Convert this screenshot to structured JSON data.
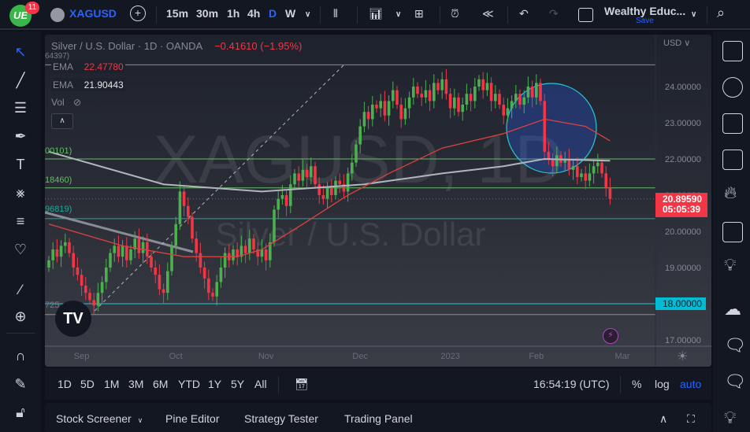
{
  "toolbar": {
    "notifications": "11",
    "symbol": "XAGUSD",
    "intervals": [
      "15m",
      "30m",
      "1h",
      "4h",
      "D",
      "W"
    ],
    "active_interval": "D",
    "layout_name": "Wealthy Educ...",
    "save_label": "Save"
  },
  "legend": {
    "title": "Silver / U.S. Dollar · 1D · OANDA",
    "change": "−0.41610 (−1.95%)",
    "cut_value": "64397)",
    "ema1_label": "EMA",
    "ema1_value": "22.47780",
    "ema2_label": "EMA",
    "ema2_value": "21.90443",
    "vol_label": "Vol"
  },
  "level_labels": [
    "00101)",
    "18460)",
    "96819)",
    "725"
  ],
  "watermark": {
    "symbol": "XAGUSD, 1D",
    "name": "Silver / U.S. Dollar"
  },
  "price_axis": {
    "currency": "USD",
    "current_price": "20.89590",
    "countdown": "05:05:39",
    "highlight_level": "18.00000"
  },
  "colors": {
    "up": "#4caf50",
    "down": "#f23645",
    "ema_fast": "#e0413f",
    "ema_slow": "#b2b5be",
    "accent": "#2962ff"
  },
  "chart_data": {
    "type": "candlestick",
    "title": "Silver / U.S. Dollar · 1D · OANDA",
    "ylim": [
      16.8,
      25.3
    ],
    "yticks": [
      17,
      18,
      19,
      20,
      21,
      22,
      23,
      24
    ],
    "ytick_labels": [
      "17.00000",
      "18.00000",
      "19.00000",
      "20.00000",
      "21.00000",
      "22.00000",
      "23.00000",
      "24.00000"
    ],
    "xticks": [
      {
        "label": "Sep",
        "index": 8
      },
      {
        "label": "Oct",
        "index": 31
      },
      {
        "label": "Nov",
        "index": 53
      },
      {
        "label": "Dec",
        "index": 76
      },
      {
        "label": "2023",
        "index": 98
      },
      {
        "label": "Feb",
        "index": 119
      },
      {
        "label": "Mar",
        "index": 140
      }
    ],
    "first_open": 19.0,
    "closes": [
      19.2,
      19.5,
      19.3,
      19.6,
      19.7,
      19.4,
      19.0,
      18.8,
      18.5,
      18.3,
      18.1,
      17.95,
      18.3,
      18.6,
      19.0,
      19.4,
      19.6,
      19.3,
      19.6,
      19.2,
      19.5,
      19.8,
      19.4,
      19.7,
      19.3,
      19.0,
      18.8,
      18.4,
      18.3,
      18.9,
      19.6,
      20.2,
      21.1,
      20.7,
      20.4,
      19.8,
      19.4,
      19.0,
      18.7,
      18.3,
      18.2,
      18.6,
      19.0,
      19.4,
      19.2,
      19.5,
      19.3,
      19.6,
      19.4,
      19.8,
      19.5,
      19.3,
      19.5,
      19.2,
      19.7,
      20.6,
      20.9,
      21.0,
      20.7,
      21.3,
      21.6,
      21.4,
      21.7,
      21.5,
      21.8,
      21.3,
      21.0,
      20.9,
      21.2,
      21.0,
      21.4,
      21.3,
      21.1,
      21.6,
      21.9,
      22.4,
      22.9,
      23.3,
      23.1,
      23.5,
      23.4,
      23.6,
      23.2,
      23.6,
      23.9,
      23.5,
      23.1,
      23.4,
      23.7,
      24.0,
      23.8,
      23.7,
      23.9,
      23.6,
      24.1,
      23.9,
      24.2,
      23.8,
      23.4,
      23.7,
      23.3,
      23.5,
      23.8,
      23.6,
      24.0,
      24.2,
      23.9,
      24.1,
      23.6,
      23.8,
      23.5,
      23.2,
      23.4,
      23.6,
      23.8,
      23.5,
      23.7,
      24.0,
      23.7,
      24.1,
      23.6,
      22.2,
      22.0,
      21.8,
      22.1,
      21.9,
      22.0,
      21.7,
      21.8,
      21.5,
      21.6,
      21.4,
      21.6,
      21.8,
      21.9,
      21.6,
      21.2,
      20.896
    ],
    "ema_fast": [
      [
        0,
        20.2
      ],
      [
        18,
        19.6
      ],
      [
        33,
        19.3
      ],
      [
        46,
        19.3
      ],
      [
        52,
        19.5
      ],
      [
        62,
        20.2
      ],
      [
        73,
        21.0
      ],
      [
        83,
        21.6
      ],
      [
        96,
        22.3
      ],
      [
        111,
        22.7
      ],
      [
        121,
        23.1
      ],
      [
        131,
        22.9
      ],
      [
        137,
        22.5
      ]
    ],
    "ema_slow": [
      [
        0,
        22.2
      ],
      [
        28,
        21.3
      ],
      [
        52,
        21.1
      ],
      [
        77,
        21.3
      ],
      [
        96,
        21.6
      ],
      [
        111,
        21.8
      ],
      [
        121,
        22.0
      ],
      [
        137,
        21.95
      ]
    ],
    "hlines": [
      {
        "value": 24.6,
        "color": "#8a8d96"
      },
      {
        "value": 22.0,
        "color": "#66bb6a"
      },
      {
        "value": 21.2,
        "color": "#66bb6a"
      },
      {
        "value": 20.35,
        "color": "#26a69a"
      },
      {
        "value": 18.0,
        "color": "#26c6da"
      },
      {
        "value": 17.7,
        "color": "#8a8d96"
      }
    ]
  },
  "bottom": {
    "ranges": [
      "1D",
      "5D",
      "1M",
      "3M",
      "6M",
      "YTD",
      "1Y",
      "5Y",
      "All"
    ],
    "time": "16:54:19 (UTC)",
    "percent": "%",
    "log": "log",
    "auto": "auto"
  },
  "panel": {
    "tabs": [
      "Stock Screener",
      "Pine Editor",
      "Strategy Tester",
      "Trading Panel"
    ]
  }
}
